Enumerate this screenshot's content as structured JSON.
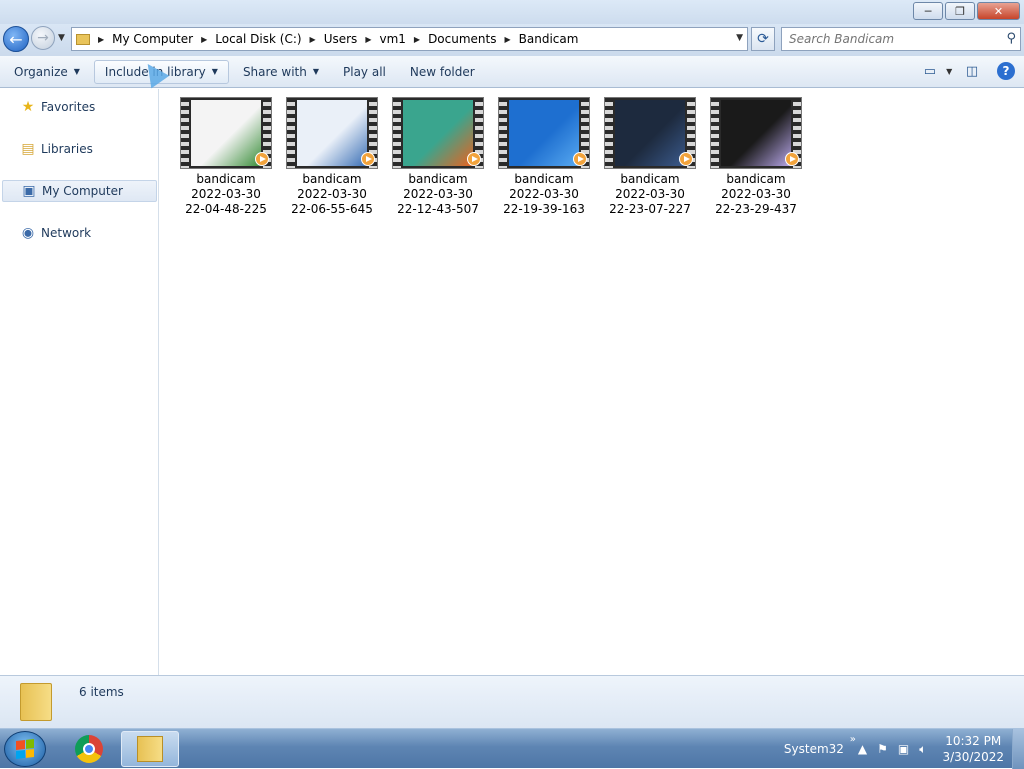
{
  "window": {
    "minimize_symbol": "─",
    "maximize_symbol": "❐",
    "close_symbol": "✕"
  },
  "address": {
    "back_symbol": "←",
    "forward_symbol": "→",
    "crumbs": [
      "My Computer",
      "Local Disk (C:)",
      "Users",
      "vm1",
      "Documents",
      "Bandicam"
    ],
    "search_placeholder": "Search Bandicam"
  },
  "toolbar": {
    "organize": "Organize",
    "include_in_library": "Include in library",
    "share_with": "Share with",
    "play_all": "Play all",
    "new_folder": "New folder"
  },
  "nav": {
    "favorites": "Favorites",
    "libraries": "Libraries",
    "my_computer": "My Computer",
    "network": "Network"
  },
  "files": [
    {
      "name": "bandicam",
      "date": "2022-03-30",
      "time": "22-04-48-225",
      "thumb_colors": [
        "#f4f4f4",
        "#3a8e3a"
      ]
    },
    {
      "name": "bandicam",
      "date": "2022-03-30",
      "time": "22-06-55-645",
      "thumb_colors": [
        "#eaf0f8",
        "#3a6fb5"
      ]
    },
    {
      "name": "bandicam",
      "date": "2022-03-30",
      "time": "22-12-43-507",
      "thumb_colors": [
        "#3aa58e",
        "#e8621f"
      ]
    },
    {
      "name": "bandicam",
      "date": "2022-03-30",
      "time": "22-19-39-163",
      "thumb_colors": [
        "#1e6fd0",
        "#58a9f0"
      ]
    },
    {
      "name": "bandicam",
      "date": "2022-03-30",
      "time": "22-23-07-227",
      "thumb_colors": [
        "#1d2a3e",
        "#3b5a8c"
      ]
    },
    {
      "name": "bandicam",
      "date": "2022-03-30",
      "time": "22-23-29-437",
      "thumb_colors": [
        "#1a1a1a",
        "#b7a6e8"
      ]
    }
  ],
  "status": {
    "item_count": "6 items"
  },
  "taskbar": {
    "system_label": "System32",
    "tray_chevron": "»",
    "time": "10:32 PM",
    "date": "3/30/2022"
  },
  "colors": {
    "accent": "#1e395b",
    "thumb_play": "#f2a33c"
  }
}
